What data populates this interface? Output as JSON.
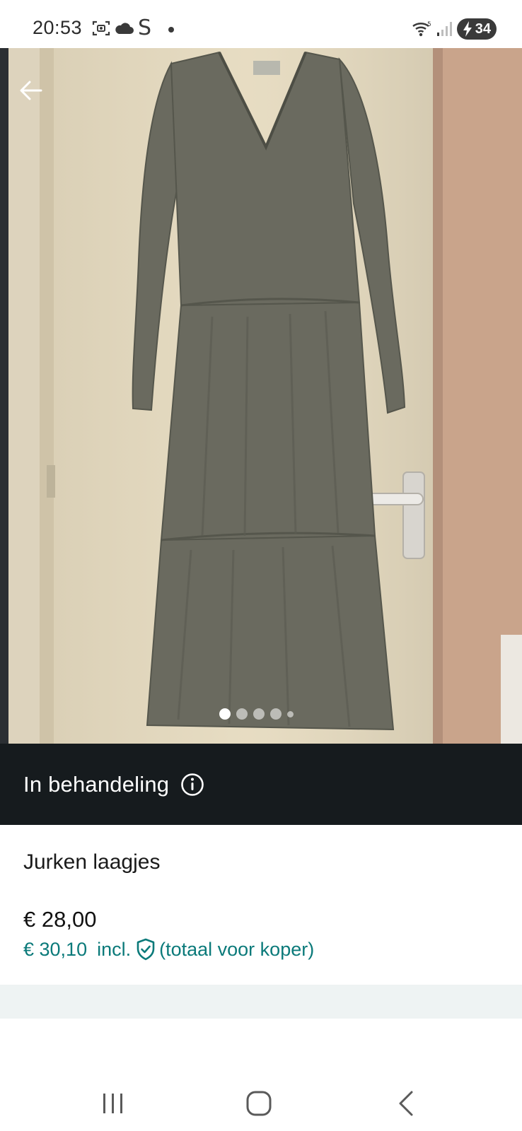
{
  "status_bar": {
    "time": "20:53",
    "carrier_glyph": "S",
    "battery": "34",
    "icons": [
      "screenshot-icon",
      "cloud-icon",
      "wifi-icon",
      "signal-icon",
      "battery-charging-icon"
    ]
  },
  "hero": {
    "image_count": 5,
    "active_index": 0,
    "back_icon": "arrow-left-icon"
  },
  "banner": {
    "status_text": "In behandeling",
    "icon": "info-icon"
  },
  "item": {
    "title": "Jurken laagjes",
    "price": "€ 28,00",
    "total_price": "€ 30,10",
    "incl_label": "incl.",
    "buyer_note": "(totaal voor koper)",
    "protection_icon": "shield-check-icon"
  },
  "colors": {
    "banner_bg": "#161b1e",
    "accent_teal": "#0b7a7a",
    "divider_band": "#eef3f3"
  },
  "navbar": {
    "icons": [
      "recents-icon",
      "home-icon",
      "nav-back-icon"
    ]
  }
}
